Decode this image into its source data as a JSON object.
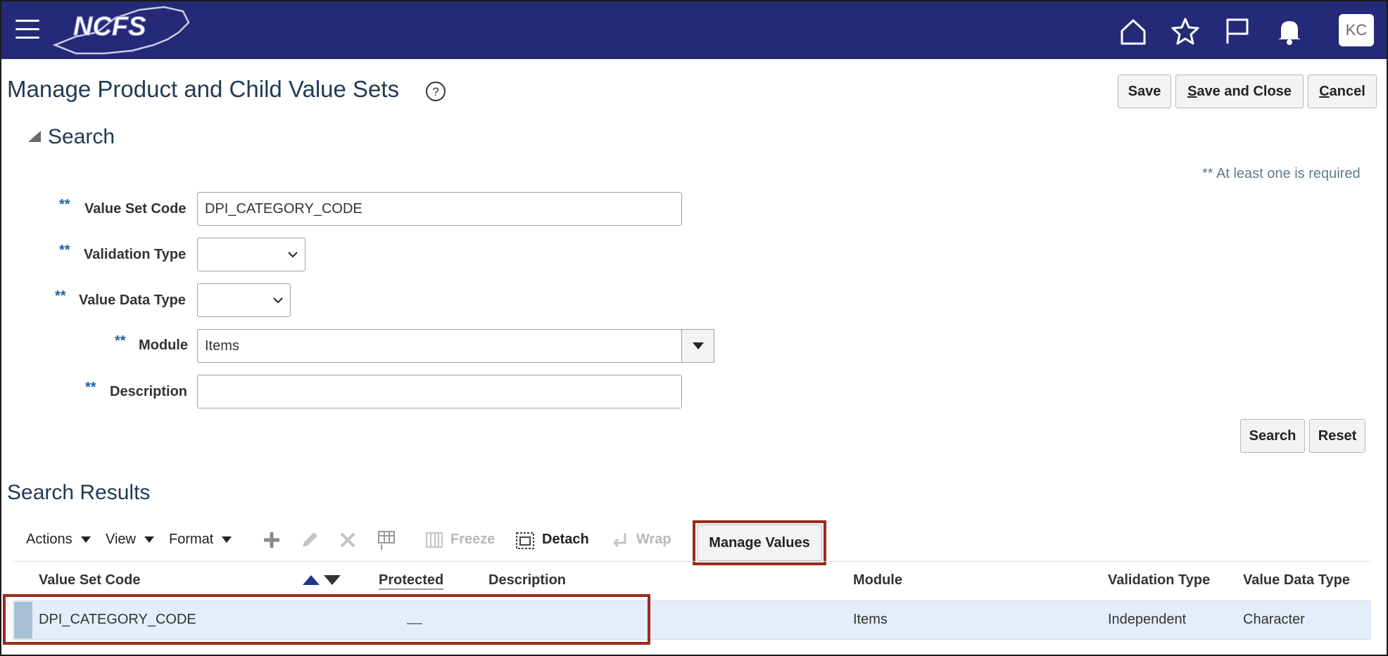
{
  "header": {
    "logo_text": "NCFS",
    "avatar_initials": "KC",
    "colors": {
      "bar": "#242a77",
      "accent": "#1e5fa8",
      "highlight_box": "#9b2a1e"
    },
    "icons": [
      "menu-icon",
      "home-icon",
      "star-icon",
      "flag-icon",
      "bell-icon"
    ]
  },
  "page": {
    "title": "Manage Product and Child Value Sets",
    "buttons": {
      "save": "Save",
      "save_close_first": "S",
      "save_close_rest": "ave and Close",
      "cancel_first": "C",
      "cancel_rest": "ancel"
    }
  },
  "search": {
    "heading": "Search",
    "required_note": "** At least one is required",
    "required_marker": "**",
    "fields": {
      "value_set_code": {
        "label": "Value Set Code",
        "value": "DPI_CATEGORY_CODE"
      },
      "validation_type": {
        "label": "Validation Type",
        "value": ""
      },
      "value_data_type": {
        "label": "Value Data Type",
        "value": ""
      },
      "module": {
        "label": "Module",
        "value": "Items"
      },
      "description": {
        "label": "Description",
        "value": ""
      }
    },
    "search_button": "Search",
    "reset_button": "Reset"
  },
  "results": {
    "heading": "Search Results",
    "toolbar": {
      "actions": "Actions",
      "view": "View",
      "format": "Format",
      "freeze": "Freeze",
      "detach": "Detach",
      "wrap": "Wrap",
      "manage_values": "Manage Values"
    },
    "columns": {
      "value_set_code": "Value Set Code",
      "protected": "Protected",
      "description": "Description",
      "module": "Module",
      "validation_type": "Validation Type",
      "value_data_type": "Value Data Type"
    },
    "rows": [
      {
        "value_set_code": "DPI_CATEGORY_CODE",
        "protected": "",
        "description": "",
        "module": "Items",
        "validation_type": "Independent",
        "value_data_type": "Character"
      }
    ]
  }
}
